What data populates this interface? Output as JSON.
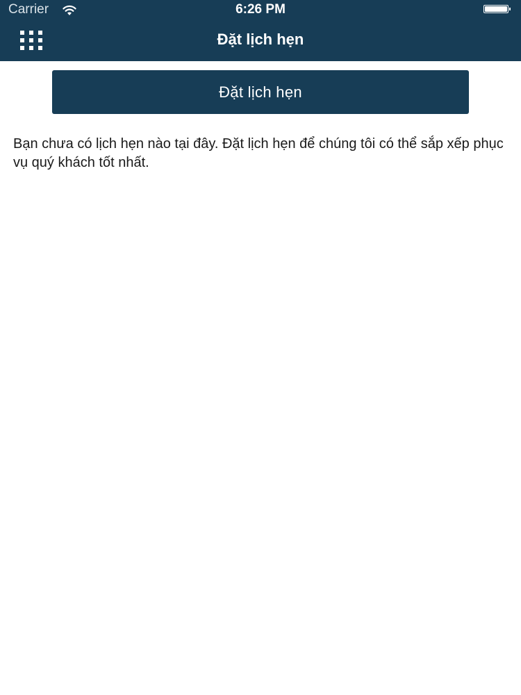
{
  "status_bar": {
    "carrier": "Carrier",
    "time": "6:26 PM",
    "wifi_icon": "wifi-icon",
    "battery_icon": "battery-icon",
    "battery_level": 1.0
  },
  "nav_bar": {
    "title": "Đặt lịch hẹn",
    "menu_icon": "grid-menu-icon"
  },
  "main": {
    "book_button_label": "Đặt lịch hẹn",
    "empty_message": "Bạn chưa có lịch hẹn nào tại đây. Đặt lịch hẹn để chúng tôi có thể sắp xếp phục vụ quý khách tốt nhất."
  },
  "colors": {
    "primary": "#173d56",
    "background": "#ffffff",
    "text": "#1a1a1a"
  }
}
